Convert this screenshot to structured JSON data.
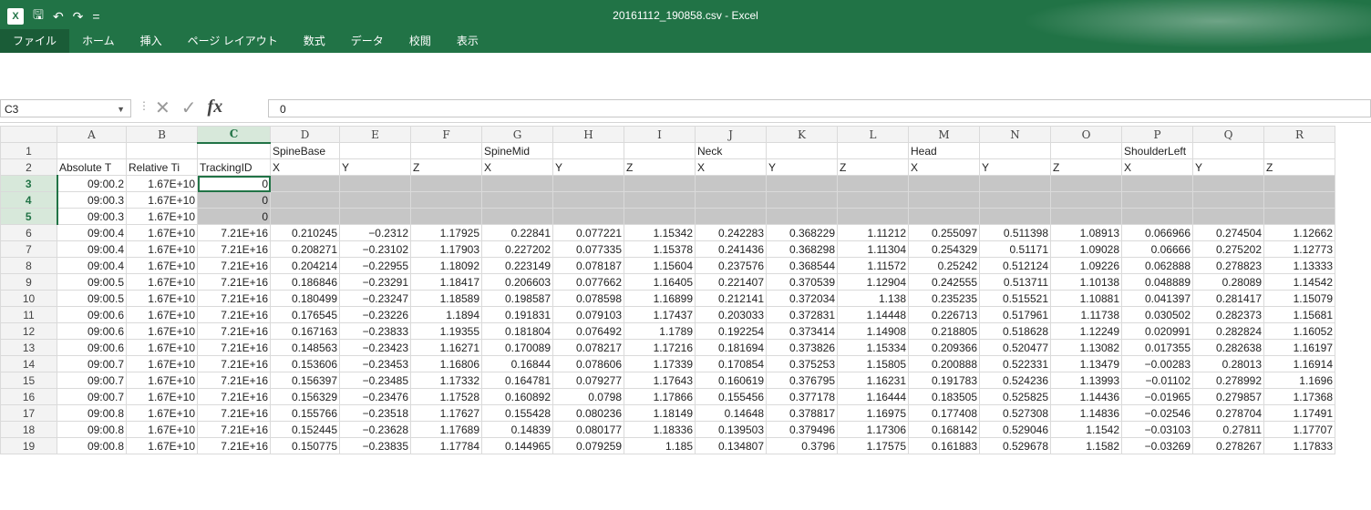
{
  "window": {
    "title": "20161112_190858.csv - Excel"
  },
  "qat": {
    "app_icon": "X",
    "save": "🖫",
    "undo": "↶",
    "redo": "↷",
    "customize": "="
  },
  "tabs": [
    "ファイル",
    "ホーム",
    "挿入",
    "ページ レイアウト",
    "数式",
    "データ",
    "校閲",
    "表示"
  ],
  "formula_bar": {
    "name_box": "C3",
    "value": "0"
  },
  "colors": {
    "accent": "#217346"
  },
  "columns": [
    "A",
    "B",
    "C",
    "D",
    "E",
    "F",
    "G",
    "H",
    "I",
    "J",
    "K",
    "L",
    "M",
    "N",
    "O",
    "P",
    "Q",
    "R"
  ],
  "col_widths": [
    76,
    78,
    80,
    76,
    78,
    78,
    78,
    78,
    78,
    78,
    78,
    78,
    78,
    78,
    78,
    78,
    78,
    78
  ],
  "selected_columns": [
    "C"
  ],
  "rows": [
    {
      "n": "1",
      "cells": [
        "",
        "",
        "",
        "SpineBase",
        "",
        "",
        "SpineMid",
        "",
        "",
        "Neck",
        "",
        "",
        "Head",
        "",
        "",
        "ShoulderLeft",
        "",
        ""
      ]
    },
    {
      "n": "2",
      "cells": [
        "Absolute T",
        "Relative Ti",
        "TrackingID",
        "X",
        "Y",
        "Z",
        "X",
        "Y",
        "Z",
        "X",
        "Y",
        "Z",
        "X",
        "Y",
        "Z",
        "X",
        "Y",
        "Z"
      ]
    },
    {
      "n": "3",
      "cells": [
        "09:00.2",
        "1.67E+10",
        "0",
        "",
        "",
        "",
        "",
        "",
        "",
        "",
        "",
        "",
        "",
        "",
        "",
        "",
        "",
        ""
      ]
    },
    {
      "n": "4",
      "cells": [
        "09:00.3",
        "1.67E+10",
        "0",
        "",
        "",
        "",
        "",
        "",
        "",
        "",
        "",
        "",
        "",
        "",
        "",
        "",
        "",
        ""
      ]
    },
    {
      "n": "5",
      "cells": [
        "09:00.3",
        "1.67E+10",
        "0",
        "",
        "",
        "",
        "",
        "",
        "",
        "",
        "",
        "",
        "",
        "",
        "",
        "",
        "",
        ""
      ]
    },
    {
      "n": "6",
      "cells": [
        "09:00.4",
        "1.67E+10",
        "7.21E+16",
        "0.210245",
        "-0.2312",
        "1.17925",
        "0.22841",
        "0.077221",
        "1.15342",
        "0.242283",
        "0.368229",
        "1.11212",
        "0.255097",
        "0.511398",
        "1.08913",
        "0.066966",
        "0.274504",
        "1.12662"
      ]
    },
    {
      "n": "7",
      "cells": [
        "09:00.4",
        "1.67E+10",
        "7.21E+16",
        "0.208271",
        "-0.23102",
        "1.17903",
        "0.227202",
        "0.077335",
        "1.15378",
        "0.241436",
        "0.368298",
        "1.11304",
        "0.254329",
        "0.51171",
        "1.09028",
        "0.06666",
        "0.275202",
        "1.12773"
      ]
    },
    {
      "n": "8",
      "cells": [
        "09:00.4",
        "1.67E+10",
        "7.21E+16",
        "0.204214",
        "-0.22955",
        "1.18092",
        "0.223149",
        "0.078187",
        "1.15604",
        "0.237576",
        "0.368544",
        "1.11572",
        "0.25242",
        "0.512124",
        "1.09226",
        "0.062888",
        "0.278823",
        "1.13333"
      ]
    },
    {
      "n": "9",
      "cells": [
        "09:00.5",
        "1.67E+10",
        "7.21E+16",
        "0.186846",
        "-0.23291",
        "1.18417",
        "0.206603",
        "0.077662",
        "1.16405",
        "0.221407",
        "0.370539",
        "1.12904",
        "0.242555",
        "0.513711",
        "1.10138",
        "0.048889",
        "0.28089",
        "1.14542"
      ]
    },
    {
      "n": "10",
      "cells": [
        "09:00.5",
        "1.67E+10",
        "7.21E+16",
        "0.180499",
        "-0.23247",
        "1.18589",
        "0.198587",
        "0.078598",
        "1.16899",
        "0.212141",
        "0.372034",
        "1.138",
        "0.235235",
        "0.515521",
        "1.10881",
        "0.041397",
        "0.281417",
        "1.15079"
      ]
    },
    {
      "n": "11",
      "cells": [
        "09:00.6",
        "1.67E+10",
        "7.21E+16",
        "0.176545",
        "-0.23226",
        "1.1894",
        "0.191831",
        "0.079103",
        "1.17437",
        "0.203033",
        "0.372831",
        "1.14448",
        "0.226713",
        "0.517961",
        "1.11738",
        "0.030502",
        "0.282373",
        "1.15681"
      ]
    },
    {
      "n": "12",
      "cells": [
        "09:00.6",
        "1.67E+10",
        "7.21E+16",
        "0.167163",
        "-0.23833",
        "1.19355",
        "0.181804",
        "0.076492",
        "1.1789",
        "0.192254",
        "0.373414",
        "1.14908",
        "0.218805",
        "0.518628",
        "1.12249",
        "0.020991",
        "0.282824",
        "1.16052"
      ]
    },
    {
      "n": "13",
      "cells": [
        "09:00.6",
        "1.67E+10",
        "7.21E+16",
        "0.148563",
        "-0.23423",
        "1.16271",
        "0.170089",
        "0.078217",
        "1.17216",
        "0.181694",
        "0.373826",
        "1.15334",
        "0.209366",
        "0.520477",
        "1.13082",
        "0.017355",
        "0.282638",
        "1.16197"
      ]
    },
    {
      "n": "14",
      "cells": [
        "09:00.7",
        "1.67E+10",
        "7.21E+16",
        "0.153606",
        "-0.23453",
        "1.16806",
        "0.16844",
        "0.078606",
        "1.17339",
        "0.170854",
        "0.375253",
        "1.15805",
        "0.200888",
        "0.522331",
        "1.13479",
        "-0.00283",
        "0.28013",
        "1.16914"
      ]
    },
    {
      "n": "15",
      "cells": [
        "09:00.7",
        "1.67E+10",
        "7.21E+16",
        "0.156397",
        "-0.23485",
        "1.17332",
        "0.164781",
        "0.079277",
        "1.17643",
        "0.160619",
        "0.376795",
        "1.16231",
        "0.191783",
        "0.524236",
        "1.13993",
        "-0.01102",
        "0.278992",
        "1.1696"
      ]
    },
    {
      "n": "16",
      "cells": [
        "09:00.7",
        "1.67E+10",
        "7.21E+16",
        "0.156329",
        "-0.23476",
        "1.17528",
        "0.160892",
        "0.0798",
        "1.17866",
        "0.155456",
        "0.377178",
        "1.16444",
        "0.183505",
        "0.525825",
        "1.14436",
        "-0.01965",
        "0.279857",
        "1.17368"
      ]
    },
    {
      "n": "17",
      "cells": [
        "09:00.8",
        "1.67E+10",
        "7.21E+16",
        "0.155766",
        "-0.23518",
        "1.17627",
        "0.155428",
        "0.080236",
        "1.18149",
        "0.14648",
        "0.378817",
        "1.16975",
        "0.177408",
        "0.527308",
        "1.14836",
        "-0.02546",
        "0.278704",
        "1.17491"
      ]
    },
    {
      "n": "18",
      "cells": [
        "09:00.8",
        "1.67E+10",
        "7.21E+16",
        "0.152445",
        "-0.23628",
        "1.17689",
        "0.14839",
        "0.080177",
        "1.18336",
        "0.139503",
        "0.379496",
        "1.17306",
        "0.168142",
        "0.529046",
        "1.1542",
        "-0.03103",
        "0.27811",
        "1.17707"
      ]
    },
    {
      "n": "19",
      "cells": [
        "09:00.8",
        "1.67E+10",
        "7.21E+16",
        "0.150775",
        "-0.23835",
        "1.17784",
        "0.144965",
        "0.079259",
        "1.185",
        "0.134807",
        "0.3796",
        "1.17575",
        "0.161883",
        "0.529678",
        "1.1582",
        "-0.03269",
        "0.278267",
        "1.17833"
      ]
    }
  ],
  "selection": {
    "rows": [
      "3",
      "4",
      "5"
    ],
    "active": "C3"
  }
}
